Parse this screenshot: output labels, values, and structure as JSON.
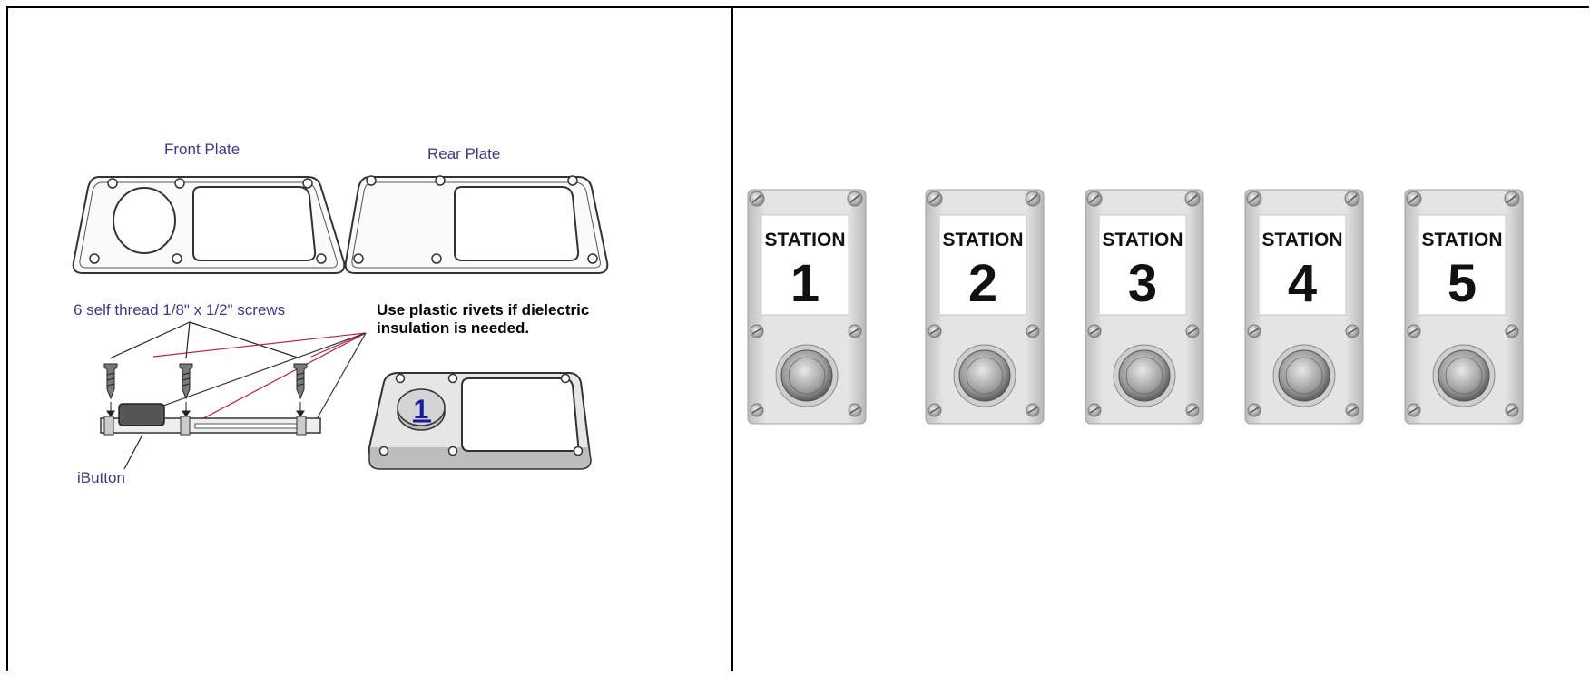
{
  "diagram": {
    "front_plate_label": "Front Plate",
    "rear_plate_label": "Rear Plate",
    "screws_label": "6 self thread 1/8\" x 1/2\" screws",
    "rivets_note_line1": "Use plastic rivets if dielectric",
    "rivets_note_line2": "insulation is needed.",
    "ibutton_label": "iButton",
    "badge_number": "1"
  },
  "stations": [
    {
      "word": "STATION",
      "number": "1"
    },
    {
      "word": "STATION",
      "number": "2"
    },
    {
      "word": "STATION",
      "number": "3"
    },
    {
      "word": "STATION",
      "number": "4"
    },
    {
      "word": "STATION",
      "number": "5"
    }
  ],
  "colors": {
    "label_blue": "#3a3a8c",
    "leader_red": "#c0203a",
    "plate_grey": "#d9d9d9"
  }
}
